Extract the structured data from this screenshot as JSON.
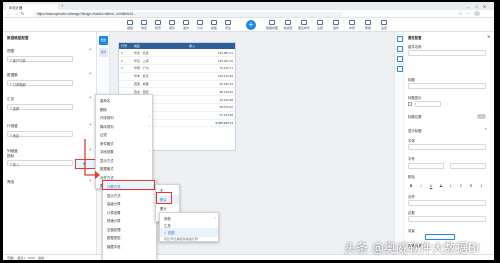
{
  "browser": {
    "tab_title": "BI设计器",
    "url": "https://www.speedbi.cn/design?design=true&id=a5bed.../e0b8b5c2d...",
    "new_tab": "+"
  },
  "toolbar": {
    "items": [
      "撤销",
      "恢复",
      "预览",
      "保存",
      "发布",
      "分享",
      "模板",
      "导出"
    ],
    "right_items": [
      "数据视图",
      "快捷键",
      "图表样式",
      "主题",
      "组件",
      "布局",
      "帮助",
      "设置"
    ]
  },
  "left_panel": {
    "header": "数据模型配置",
    "sections": [
      {
        "title": "视图",
        "value": "T 客户订单"
      },
      {
        "title": "数据集",
        "value": "T 订单明细"
      },
      {
        "title": "汇总",
        "value": "T 金额"
      },
      {
        "title": "行维度",
        "value": "T 地区"
      },
      {
        "title": "列维度",
        "value": ""
      },
      {
        "title": "指标",
        "value": "T 收入"
      },
      {
        "title": "筛选",
        "value": ""
      }
    ]
  },
  "strip": {
    "items": [
      "数据",
      "组件"
    ]
  },
  "report": {
    "headers": [
      "行号",
      "地区",
      "收入"
    ],
    "rows": [
      [
        "1",
        "华北 · 北京",
        "126,981.21"
      ],
      [
        "2",
        "华东 · 上海",
        "125,457.25"
      ],
      [
        "3",
        "华南 · 广州",
        "75,152.71"
      ],
      [
        "",
        "华中 · 武汉",
        "100,214.83"
      ],
      [
        "",
        "西南 · 成都",
        "60,332.15"
      ],
      [
        "",
        "西北 · 西安",
        "88,140.52"
      ],
      [
        "",
        "东北 · 沈阳",
        "46,222.98"
      ],
      [
        "",
        "华东 · 杭州",
        "58,470.02"
      ],
      [
        "",
        "华南 · 深圳",
        "57,123.68"
      ]
    ],
    "total_label": "合计",
    "total_value": "6,025,379.71"
  },
  "menu1": {
    "items": [
      "重命名",
      "删除",
      "升序排列",
      "降序排列",
      "过滤",
      "条件格式",
      "字段设置",
      "显示方式",
      "数据格式",
      "对齐方式",
      "属性"
    ]
  },
  "menu2": {
    "items": [
      "计算方式",
      "显示方式",
      "高级计算",
      "计算设置",
      "快速计算",
      "空值处理",
      "数据类型",
      "隐藏字段",
      "值显示为",
      "字段说明",
      "取消"
    ]
  },
  "menu3": {
    "items": [
      "无",
      "默认",
      "累计",
      "占比"
    ]
  },
  "menu4": {
    "items": [
      "其他",
      "汇总",
      "✓ 总额",
      "同比/环比等复杂快速计算"
    ]
  },
  "right_panel": {
    "title": "属性配置",
    "labels": [
      "组件名称",
      "标题",
      "标题显示",
      "标题位置",
      "显示标题",
      "字体",
      "字号",
      "颜色",
      "对齐",
      "边框",
      "背景",
      "高级设置",
      "数据联动",
      "交互设置"
    ],
    "format_buttons": [
      "B",
      "I",
      "U",
      "S",
      "L",
      "C",
      "R",
      "J"
    ]
  },
  "statusbar": {
    "text": "页面1  ·  报表1  ·  100%  ·  缩放"
  },
  "watermark": "头条 @奥威软件大数据BI"
}
